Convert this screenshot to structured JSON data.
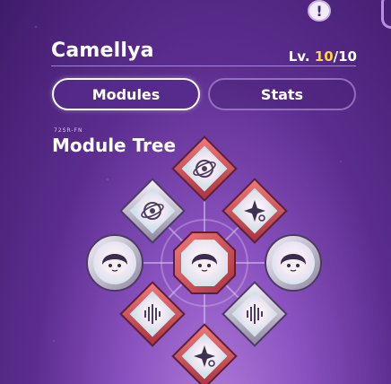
{
  "header": {
    "character_name": "Camellya",
    "level_prefix": "Lv. ",
    "level_current": "10",
    "level_max": "/10",
    "accent_color": "#ffd44a"
  },
  "alert": {
    "glyph": "!",
    "icon": "exclamation-icon"
  },
  "tabs": [
    {
      "label": "Modules",
      "active": true
    },
    {
      "label": "Stats",
      "active": false
    }
  ],
  "section": {
    "code": "72SR-FN",
    "title": "Module Tree"
  },
  "modules": [
    {
      "id": "top",
      "icon": "orbit-emblem-icon",
      "frame": "red"
    },
    {
      "id": "upper-left",
      "icon": "orbit-emblem-icon",
      "frame": "silver"
    },
    {
      "id": "upper-right",
      "icon": "sparkle-icon",
      "frame": "red"
    },
    {
      "id": "left",
      "icon": "character-portrait-icon",
      "frame": "silver"
    },
    {
      "id": "center",
      "icon": "character-portrait-icon",
      "frame": "red"
    },
    {
      "id": "right",
      "icon": "character-portrait-icon",
      "frame": "silver"
    },
    {
      "id": "lower-left",
      "icon": "soundwave-icon",
      "frame": "red"
    },
    {
      "id": "lower-right",
      "icon": "soundwave-icon",
      "frame": "silver"
    },
    {
      "id": "bottom",
      "icon": "sparkle-icon",
      "frame": "red"
    }
  ]
}
